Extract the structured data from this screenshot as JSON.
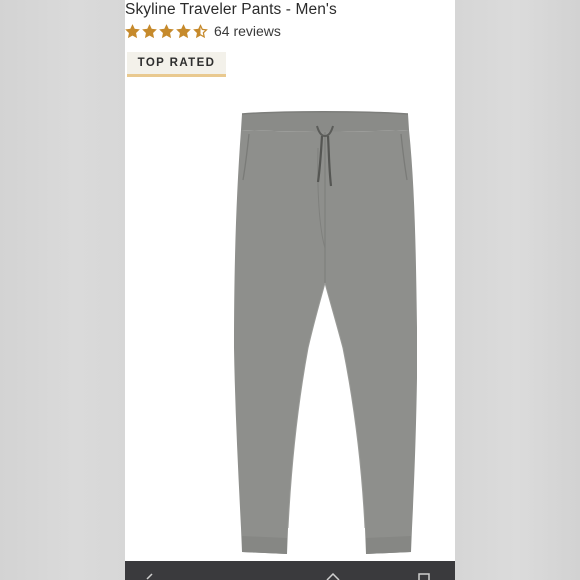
{
  "product": {
    "title": "Skyline Traveler Pants - Men's",
    "rating": 4.5,
    "rating_max": 5,
    "reviews_label": "64 reviews",
    "badge": "TOP RATED",
    "image_icon": "gray-jogger-pants-image"
  },
  "colors": {
    "star": "#c68a2c",
    "badge_underline": "#e9c98f",
    "pants": "#8e8f8c",
    "bottom_bar": "#3a3a3d"
  },
  "bottom_nav": {
    "icons": [
      "back-icon",
      "home-icon",
      "tabs-icon"
    ]
  }
}
